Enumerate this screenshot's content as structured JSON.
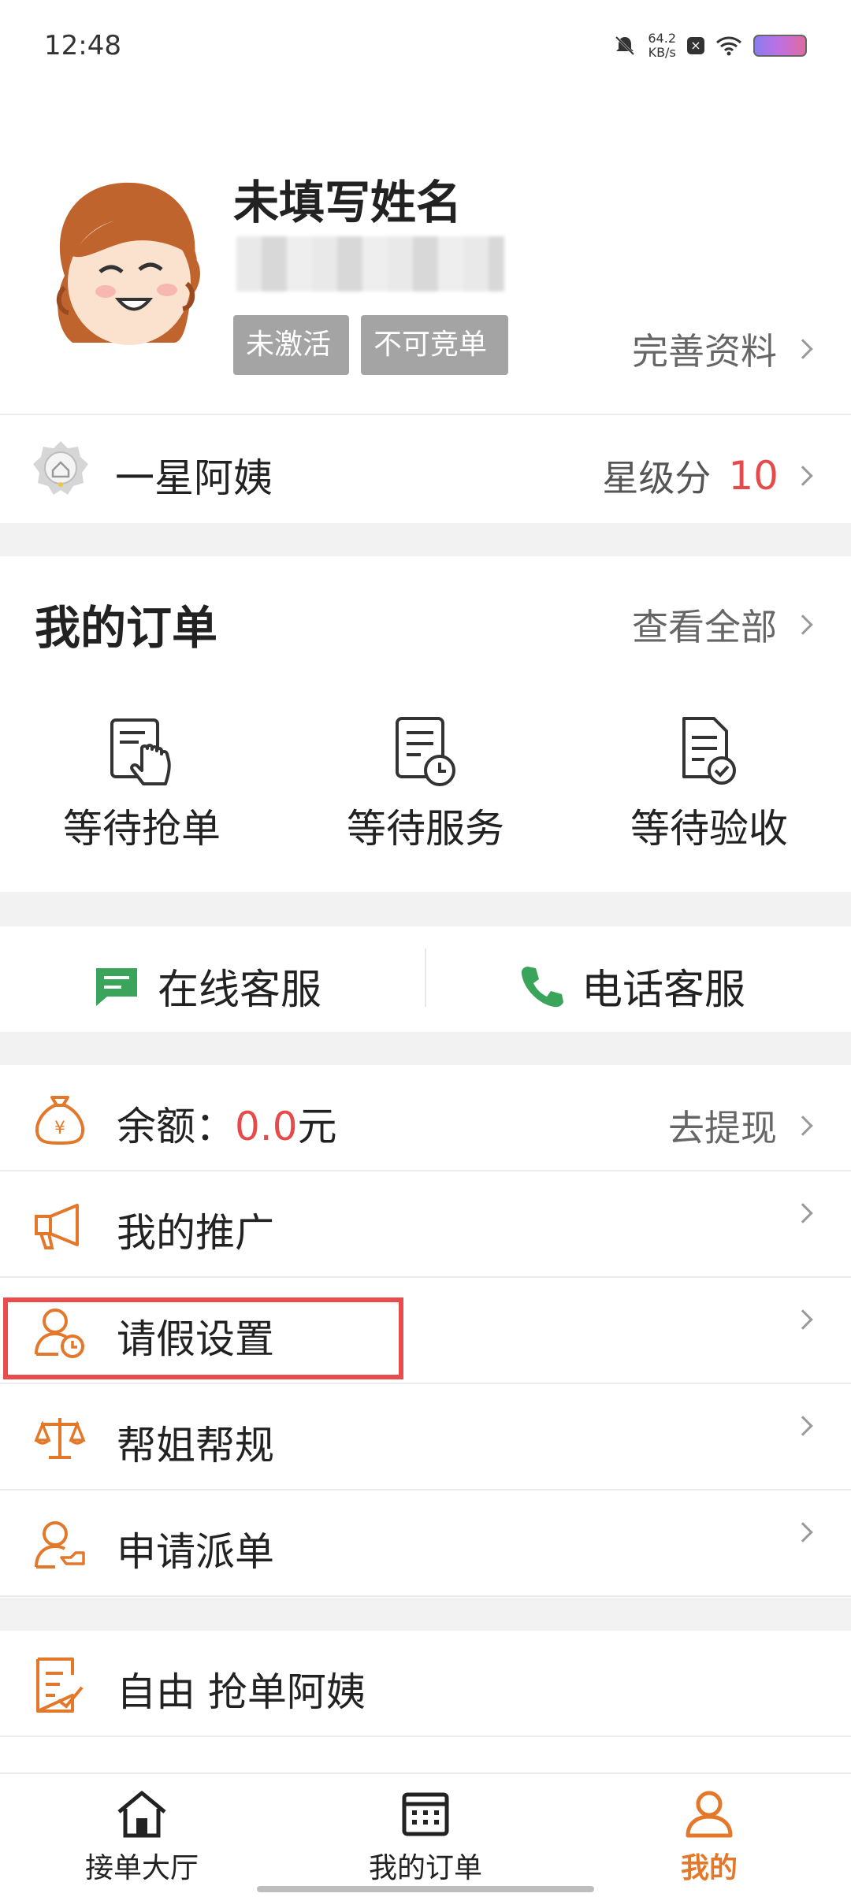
{
  "status_bar": {
    "time": "12:48",
    "net_speed_value": "64.2",
    "net_speed_unit": "KB/s"
  },
  "profile": {
    "name": "未填写姓名",
    "tags": [
      "未激活",
      "不可竞单"
    ],
    "complete_link": "完善资料"
  },
  "star_level": {
    "label": "一星阿姨",
    "score_label": "星级分",
    "score": "10"
  },
  "orders": {
    "title": "我的订单",
    "view_all": "查看全部",
    "items": [
      {
        "label": "等待抢单",
        "icon": "hand-tap-document-icon"
      },
      {
        "label": "等待服务",
        "icon": "document-clock-icon"
      },
      {
        "label": "等待验收",
        "icon": "document-check-icon"
      }
    ]
  },
  "service": {
    "online": "在线客服",
    "phone": "电话客服"
  },
  "menu": {
    "balance": {
      "label": "余额：",
      "amount": "0.0",
      "unit": "元",
      "action": "去提现"
    },
    "promotion": "我的推广",
    "leave": "请假设置",
    "rules": "帮姐帮规",
    "dispatch": "申请派单",
    "free_grab": "自由 抢单阿姨"
  },
  "tabbar": {
    "items": [
      {
        "label": "接单大厅",
        "icon": "home-icon",
        "active": false
      },
      {
        "label": "我的订单",
        "icon": "calendar-icon",
        "active": false
      },
      {
        "label": "我的",
        "icon": "person-icon",
        "active": true
      }
    ]
  },
  "colors": {
    "accent": "#e4782a",
    "highlight_box": "#e84c4c",
    "money": "#e64a4a"
  }
}
